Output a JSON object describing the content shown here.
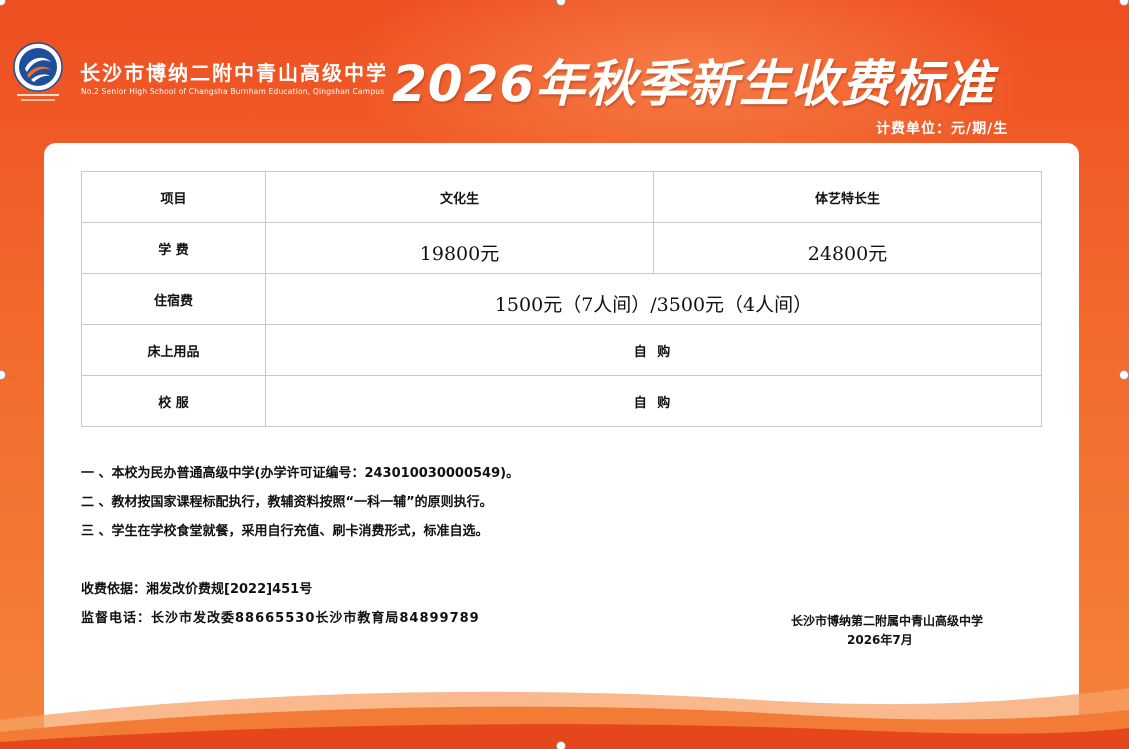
{
  "header": {
    "school_name_cn": "长沙市博纳二附中青山高级中学",
    "school_name_en": "No.2 Senior High School of Changsha Burnham Education, Qingshan Campus",
    "title": "2026年秋季新生收费标准",
    "unit": "计费单位：元/期/生"
  },
  "table": {
    "headers": [
      "项目",
      "文化生",
      "体艺特长生"
    ],
    "tuition": {
      "label": "学 费",
      "culture": "19800元",
      "arts": "24800元"
    },
    "dorm": {
      "label": "住宿费",
      "value": "1500元（7人间）/3500元（4人间）"
    },
    "bedding": {
      "label": "床上用品",
      "value": "自 购"
    },
    "uniform": {
      "label": "校 服",
      "value": "自 购"
    }
  },
  "notes": [
    "一 、本校为民办普通高级中学(办学许可证编号：243010030000549)。",
    "二 、教材按国家课程标配执行，教辅资料按照“一科一辅”的原则执行。",
    "三 、学生在学校食堂就餐，采用自行充值、刷卡消费形式，标准自选。"
  ],
  "footer": {
    "basis": "收费依据：湘发改价费规[2022]451号",
    "phone": "监督电话：长沙市发改委88665530长沙市教育局84899789",
    "signature": "长沙市博纳第二附属中青山高级中学",
    "date": "2026年7月"
  },
  "colors": {
    "background": "#ee4f22",
    "logo_blue": "#1f4e9c",
    "panel": "#ffffff"
  },
  "icons": [
    "school-logo-icon"
  ]
}
